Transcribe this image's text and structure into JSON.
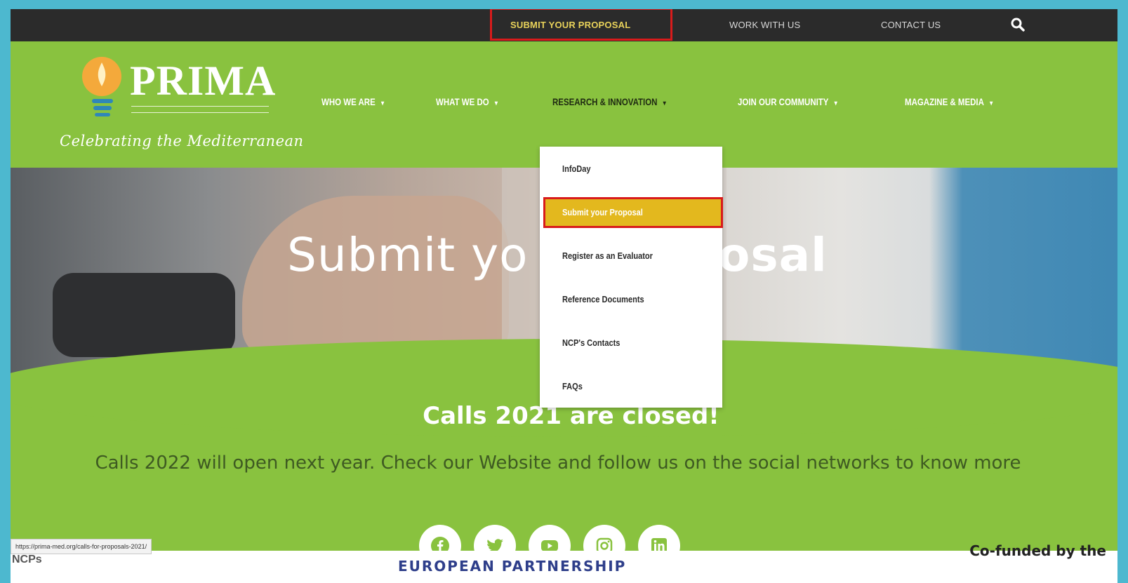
{
  "topbar": {
    "submit_label": "SUBMIT YOUR PROPOSAL",
    "work_label": "WORK WITH US",
    "contact_label": "CONTACT US"
  },
  "brand": {
    "logo_text": "PRIMA",
    "tagline": "Celebrating the Mediterranean"
  },
  "nav": {
    "items": [
      {
        "label": "WHO WE ARE"
      },
      {
        "label": "WHAT WE DO"
      },
      {
        "label": "RESEARCH & INNOVATION"
      },
      {
        "label": "JOIN OUR COMMUNITY"
      },
      {
        "label": "MAGAZINE & MEDIA"
      }
    ]
  },
  "hero": {
    "title_left": "Submit yo",
    "title_right": "osal"
  },
  "dropdown": {
    "items": [
      {
        "label": "InfoDay"
      },
      {
        "label": "Submit your Proposal"
      },
      {
        "label": "Register as an Evaluator"
      },
      {
        "label": "Reference Documents"
      },
      {
        "label": "NCP's Contacts"
      },
      {
        "label": "FAQs"
      }
    ]
  },
  "content": {
    "calls_title": "Calls 2021 are closed!",
    "calls_text": "Calls 2022 will open next year. Check our Website and follow us on the social networks to know more"
  },
  "social": [
    "facebook-icon",
    "twitter-icon",
    "youtube-icon",
    "instagram-icon",
    "linkedin-icon"
  ],
  "footer": {
    "status_url": "https://prima-med.org/calls-for-proposals-2021/",
    "ncps_label": "NCPs",
    "partnership": "EUROPEAN PARTNERSHIP",
    "cofunded": "Co-funded by the"
  },
  "colors": {
    "page_bg": "#89c23f",
    "topbar_bg": "#2b2b2b",
    "highlight": "#e3b81e",
    "annotation_red": "#d81b1b",
    "frame": "#4db8cf"
  }
}
